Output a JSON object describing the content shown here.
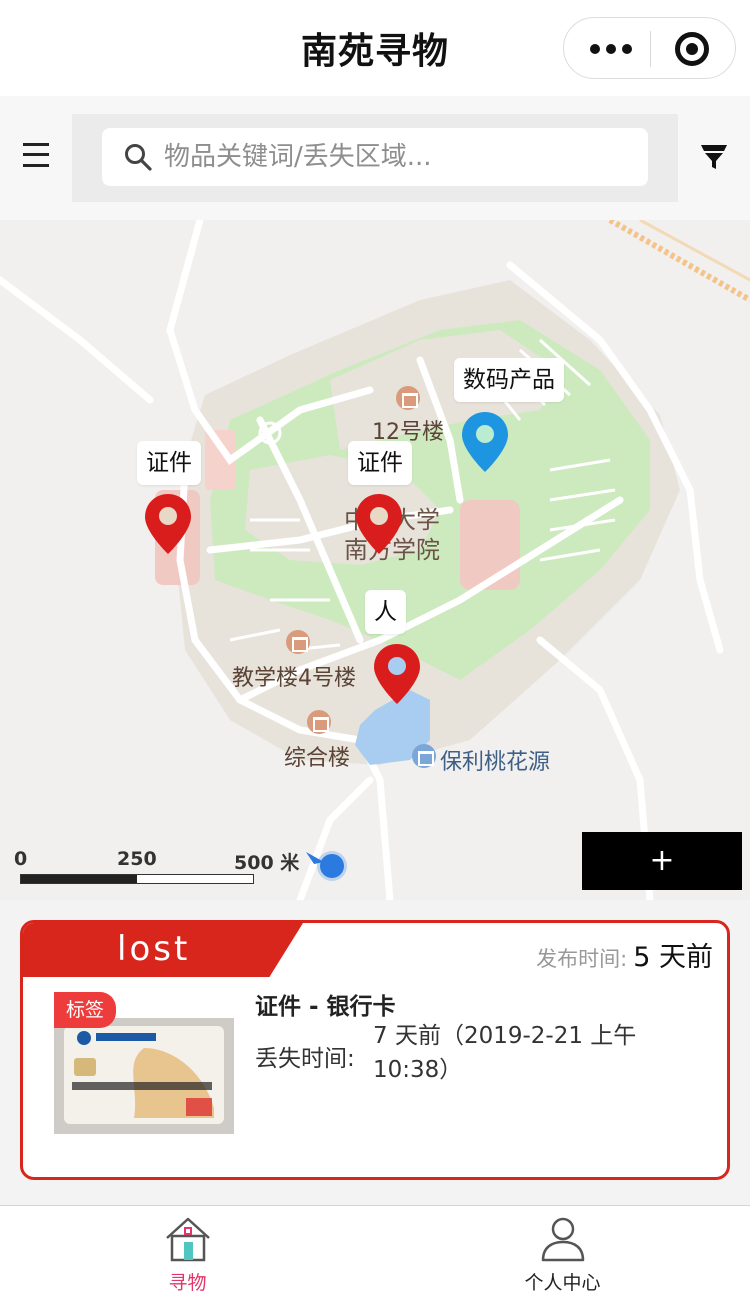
{
  "window": {
    "title": "南苑寻物"
  },
  "search": {
    "placeholder": "物品关键词/丢失区域..."
  },
  "map": {
    "pois": {
      "building12": "12号楼",
      "campus_line1": "中山大学",
      "campus_line2": "南方学院",
      "teaching4": "教学楼4号楼",
      "complex": "综合楼",
      "residential": "保利桃花源"
    },
    "markers": [
      {
        "label": "证件",
        "color": "#d91d1d"
      },
      {
        "label": "证件",
        "color": "#d91d1d"
      },
      {
        "label": "数码产品",
        "color": "#1e95e0"
      },
      {
        "label": "人",
        "color": "#d91d1d"
      }
    ],
    "scale": {
      "zero": "0",
      "mid": "250",
      "end": "500 米"
    },
    "add_button": "+"
  },
  "card": {
    "status": "lost",
    "publish_label": "发布时间:",
    "publish_value": "5 天前",
    "tag": "标签",
    "title": "证件 - 银行卡",
    "lost_label": "丢失时间:",
    "lost_value": "7 天前（2019-2-21 上午 10:38）",
    "accent_color": "#d9261c"
  },
  "tabbar": {
    "tabs": [
      {
        "label": "寻物",
        "icon": "home-icon",
        "active": true
      },
      {
        "label": "个人中心",
        "icon": "user-icon",
        "active": false
      }
    ]
  }
}
